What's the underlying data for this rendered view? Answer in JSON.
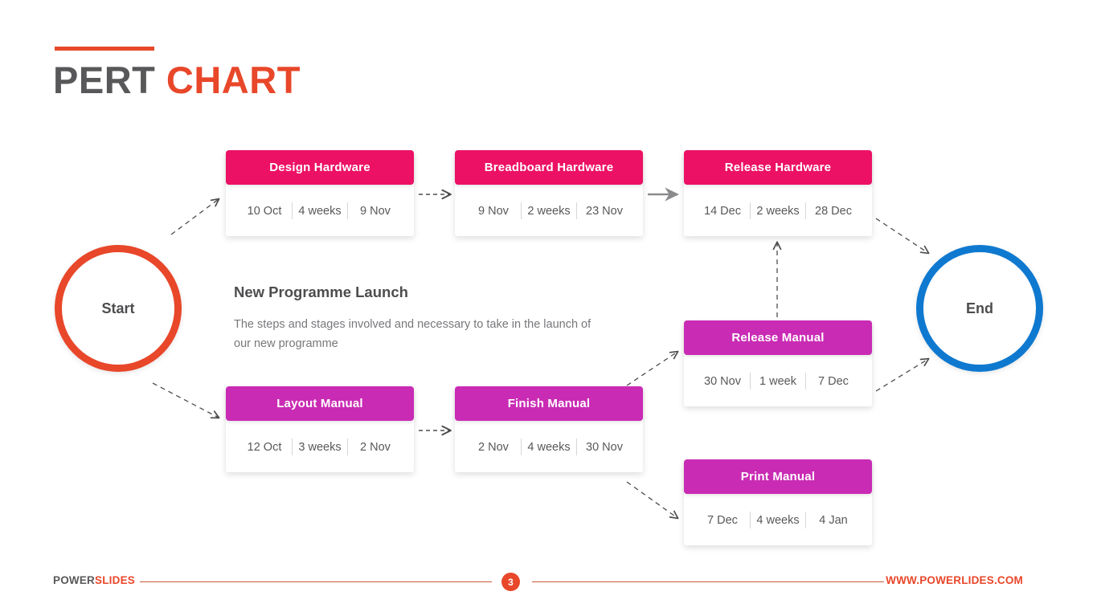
{
  "title": {
    "primary": "PERT ",
    "accent": "CHART"
  },
  "nodes": {
    "start": {
      "label": "Start",
      "color": "#e8472a"
    },
    "end": {
      "label": "End",
      "color": "#0f79d0"
    }
  },
  "center": {
    "heading": "New Programme Launch",
    "description": "The steps and stages involved and necessary to take in the launch of our new programme"
  },
  "colors": {
    "hardware_track": "#ec1165",
    "manual_track": "#c92bb4",
    "accent": "#e8472a",
    "end_blue": "#0f79d0",
    "text_dark": "#4d4d4f",
    "text_muted": "#77787b"
  },
  "chart_data": {
    "type": "diagram",
    "title": "PERT CHART",
    "tasks": [
      {
        "id": "design-hardware",
        "label": "Design Hardware",
        "start": "10 Oct",
        "duration": "4 weeks",
        "finish": "9 Nov",
        "track": "hardware"
      },
      {
        "id": "breadboard-hardware",
        "label": "Breadboard Hardware",
        "start": "9 Nov",
        "duration": "2 weeks",
        "finish": "23 Nov",
        "track": "hardware"
      },
      {
        "id": "release-hardware",
        "label": "Release Hardware",
        "start": "14 Dec",
        "duration": "2 weeks",
        "finish": "28 Dec",
        "track": "hardware"
      },
      {
        "id": "layout-manual",
        "label": "Layout Manual",
        "start": "12 Oct",
        "duration": "3 weeks",
        "finish": "2 Nov",
        "track": "manual"
      },
      {
        "id": "finish-manual",
        "label": "Finish Manual",
        "start": "2 Nov",
        "duration": "4 weeks",
        "finish": "30 Nov",
        "track": "manual"
      },
      {
        "id": "release-manual",
        "label": "Release Manual",
        "start": "30 Nov",
        "duration": "1 week",
        "finish": "7 Dec",
        "track": "manual"
      },
      {
        "id": "print-manual",
        "label": "Print Manual",
        "start": "7 Dec",
        "duration": "4 weeks",
        "finish": "4 Jan",
        "track": "manual"
      }
    ],
    "edges": [
      {
        "from": "start",
        "to": "design-hardware",
        "style": "dashed"
      },
      {
        "from": "start",
        "to": "layout-manual",
        "style": "dashed"
      },
      {
        "from": "design-hardware",
        "to": "breadboard-hardware",
        "style": "dashed"
      },
      {
        "from": "breadboard-hardware",
        "to": "release-hardware",
        "style": "solid"
      },
      {
        "from": "layout-manual",
        "to": "finish-manual",
        "style": "dashed"
      },
      {
        "from": "finish-manual",
        "to": "release-manual",
        "style": "dashed"
      },
      {
        "from": "finish-manual",
        "to": "print-manual",
        "style": "dashed"
      },
      {
        "from": "release-manual",
        "to": "release-hardware",
        "style": "dashed"
      },
      {
        "from": "release-hardware",
        "to": "end",
        "style": "dashed"
      },
      {
        "from": "release-manual",
        "to": "end",
        "style": "dashed"
      }
    ]
  },
  "footer": {
    "logo_primary": "POWER",
    "logo_accent": "SLIDES",
    "page_number": "3",
    "url": "WWW.POWERLIDES.COM"
  }
}
